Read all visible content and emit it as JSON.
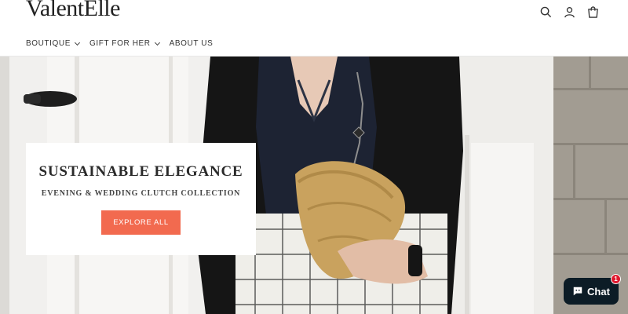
{
  "brand": {
    "logo_text": "ValentElle"
  },
  "nav": {
    "items": [
      {
        "label": "BOUTIQUE",
        "has_dropdown": true
      },
      {
        "label": "GIFT FOR HER",
        "has_dropdown": true
      },
      {
        "label": "ABOUT US",
        "has_dropdown": false
      }
    ]
  },
  "header_icons": [
    "search-icon",
    "account-icon",
    "cart-icon"
  ],
  "hero": {
    "title": "SUSTAINABLE ELEGANCE",
    "subtitle": "EVENING & WEDDING CLUTCH COLLECTION",
    "cta_label": "EXPLORE ALL"
  },
  "chat": {
    "label": "Chat",
    "badge_count": "1"
  },
  "colors": {
    "accent": "#f26a4f",
    "chat_bg": "#0c1c26",
    "badge": "#e0182d"
  }
}
